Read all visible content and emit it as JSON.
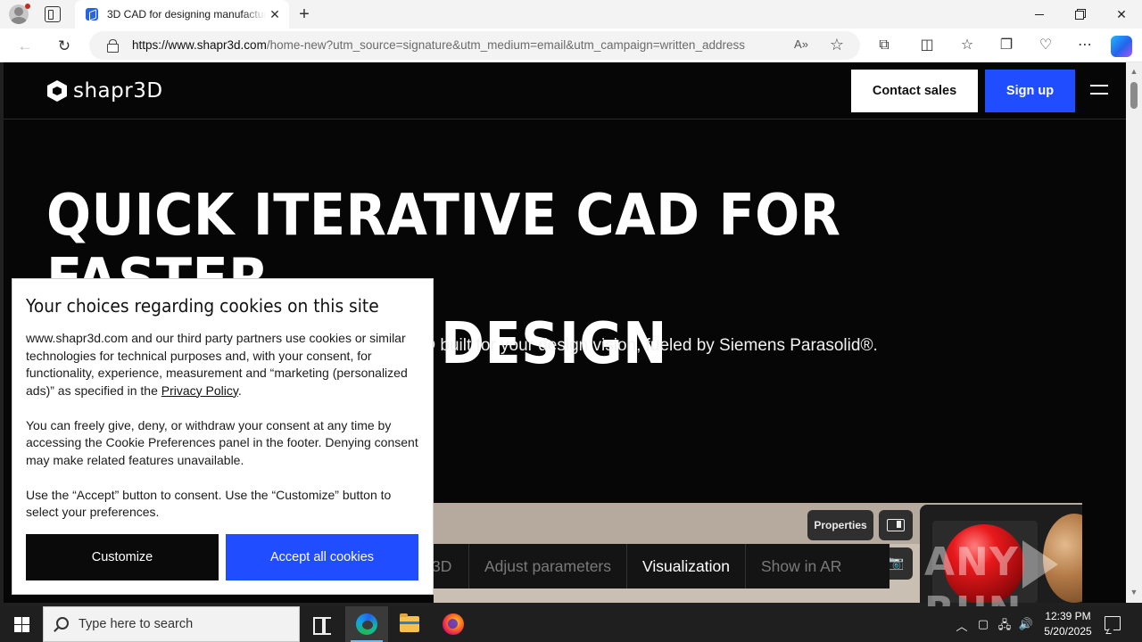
{
  "browser": {
    "tab_title": "3D CAD for designing manufacturable products",
    "tab_close": "✕",
    "new_tab": "+",
    "url_domain": "https://www.shapr3d.com",
    "url_path": "/home-new?utm_source=signature&utm_medium=email&utm_campaign=written_address",
    "window_controls": {
      "close": "✕"
    }
  },
  "header": {
    "logo_text": "shapr3D",
    "contact_label": "Contact sales",
    "signup_label": "Sign up"
  },
  "hero": {
    "headline_line1": "QUICK ITERATIVE CAD FOR FASTER",
    "headline_line2": "AND BETTER DESIGN DECISIONS.",
    "subline": "Bring your design vision to life in 3D. Precision CAD built for your design vision, fueled by Siemens Parasolid®."
  },
  "app_preview": {
    "properties_label": "Properties",
    "tabs": [
      {
        "label": "3D"
      },
      {
        "label": "Adjust parameters"
      },
      {
        "label": "Visualization"
      },
      {
        "label": "Show in AR"
      }
    ]
  },
  "cookie": {
    "title": "Your choices regarding cookies on this site",
    "p1_before_link": "www.shapr3d.com and our third party partners use cookies or similar technologies for technical purposes and, with your consent, for functionality, experience, measurement and “marketing (personalized ads)” as specified in the ",
    "p1_link": "Privacy Policy",
    "p1_after_link": ".",
    "p2": "You can freely give, deny, or withdraw your consent at any time by accessing the Cookie Preferences panel in the footer. Denying consent may make related features unavailable.",
    "p3": "Use the “Accept” button to consent. Use the “Customize” button to select your preferences.",
    "customize_label": "Customize",
    "accept_label": "Accept all cookies"
  },
  "watermark": {
    "left": "ANY",
    "right": "RUN"
  },
  "taskbar": {
    "search_placeholder": "Type here to search",
    "time": "12:39 PM",
    "date": "5/20/2025"
  }
}
